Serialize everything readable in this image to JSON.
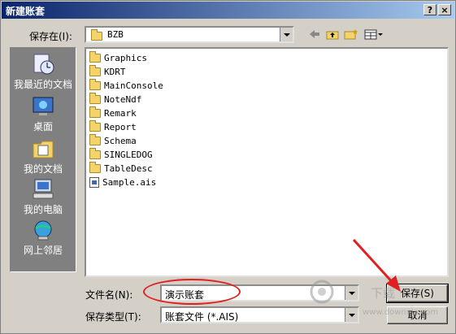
{
  "dialog": {
    "title": "新建账套",
    "help_label": "?",
    "close_label": "×"
  },
  "save_in": {
    "label": "保存在(I):",
    "value": "BZB"
  },
  "places": [
    {
      "label": "我最近的文档",
      "icon": "recent-documents-icon"
    },
    {
      "label": "桌面",
      "icon": "desktop-icon"
    },
    {
      "label": "我的文档",
      "icon": "my-documents-icon"
    },
    {
      "label": "我的电脑",
      "icon": "my-computer-icon"
    },
    {
      "label": "网上邻居",
      "icon": "network-places-icon"
    }
  ],
  "files": [
    {
      "name": "Graphics",
      "type": "folder"
    },
    {
      "name": "KDRT",
      "type": "folder"
    },
    {
      "name": "MainConsole",
      "type": "folder"
    },
    {
      "name": "NoteNdf",
      "type": "folder"
    },
    {
      "name": "Remark",
      "type": "folder"
    },
    {
      "name": "Report",
      "type": "folder"
    },
    {
      "name": "Schema",
      "type": "folder"
    },
    {
      "name": "SINGLEDOG",
      "type": "folder"
    },
    {
      "name": "TableDesc",
      "type": "folder"
    },
    {
      "name": "Sample.ais",
      "type": "file"
    }
  ],
  "filename": {
    "label": "文件名(N):",
    "value": "演示账套"
  },
  "filetype": {
    "label": "保存类型(T):",
    "value": "账套文件 (*.AIS)"
  },
  "buttons": {
    "save": "保存(S)",
    "cancel": "取消"
  },
  "watermark": {
    "text1": "下载",
    "text2": "www.downxia.com"
  },
  "colors": {
    "annotation": "#e02020"
  }
}
